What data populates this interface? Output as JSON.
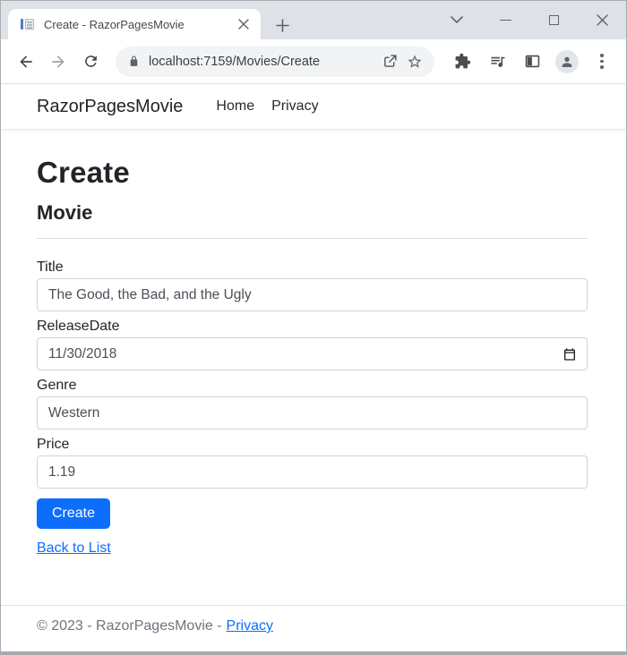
{
  "chrome": {
    "tab": {
      "title": "Create - RazorPagesMovie"
    },
    "address": {
      "url": "localhost:7159/Movies/Create"
    }
  },
  "navbar": {
    "brand": "RazorPagesMovie",
    "links": [
      {
        "label": "Home"
      },
      {
        "label": "Privacy"
      }
    ]
  },
  "main": {
    "title": "Create",
    "subtitle": "Movie"
  },
  "form": {
    "fields": [
      {
        "label": "Title",
        "value": "The Good, the Bad, and the Ugly"
      },
      {
        "label": "ReleaseDate",
        "value": "11/30/2018"
      },
      {
        "label": "Genre",
        "value": "Western"
      },
      {
        "label": "Price",
        "value": "1.19"
      }
    ],
    "submit_label": "Create",
    "back_link_label": "Back to List"
  },
  "footer": {
    "copyright": "© 2023 - RazorPagesMovie -",
    "privacy_label": "Privacy"
  },
  "colors": {
    "primary": "#0d6efd",
    "link": "#0d6efd",
    "titlebar_bg": "#dee1e6",
    "omnibox_bg": "#f1f3f4"
  }
}
